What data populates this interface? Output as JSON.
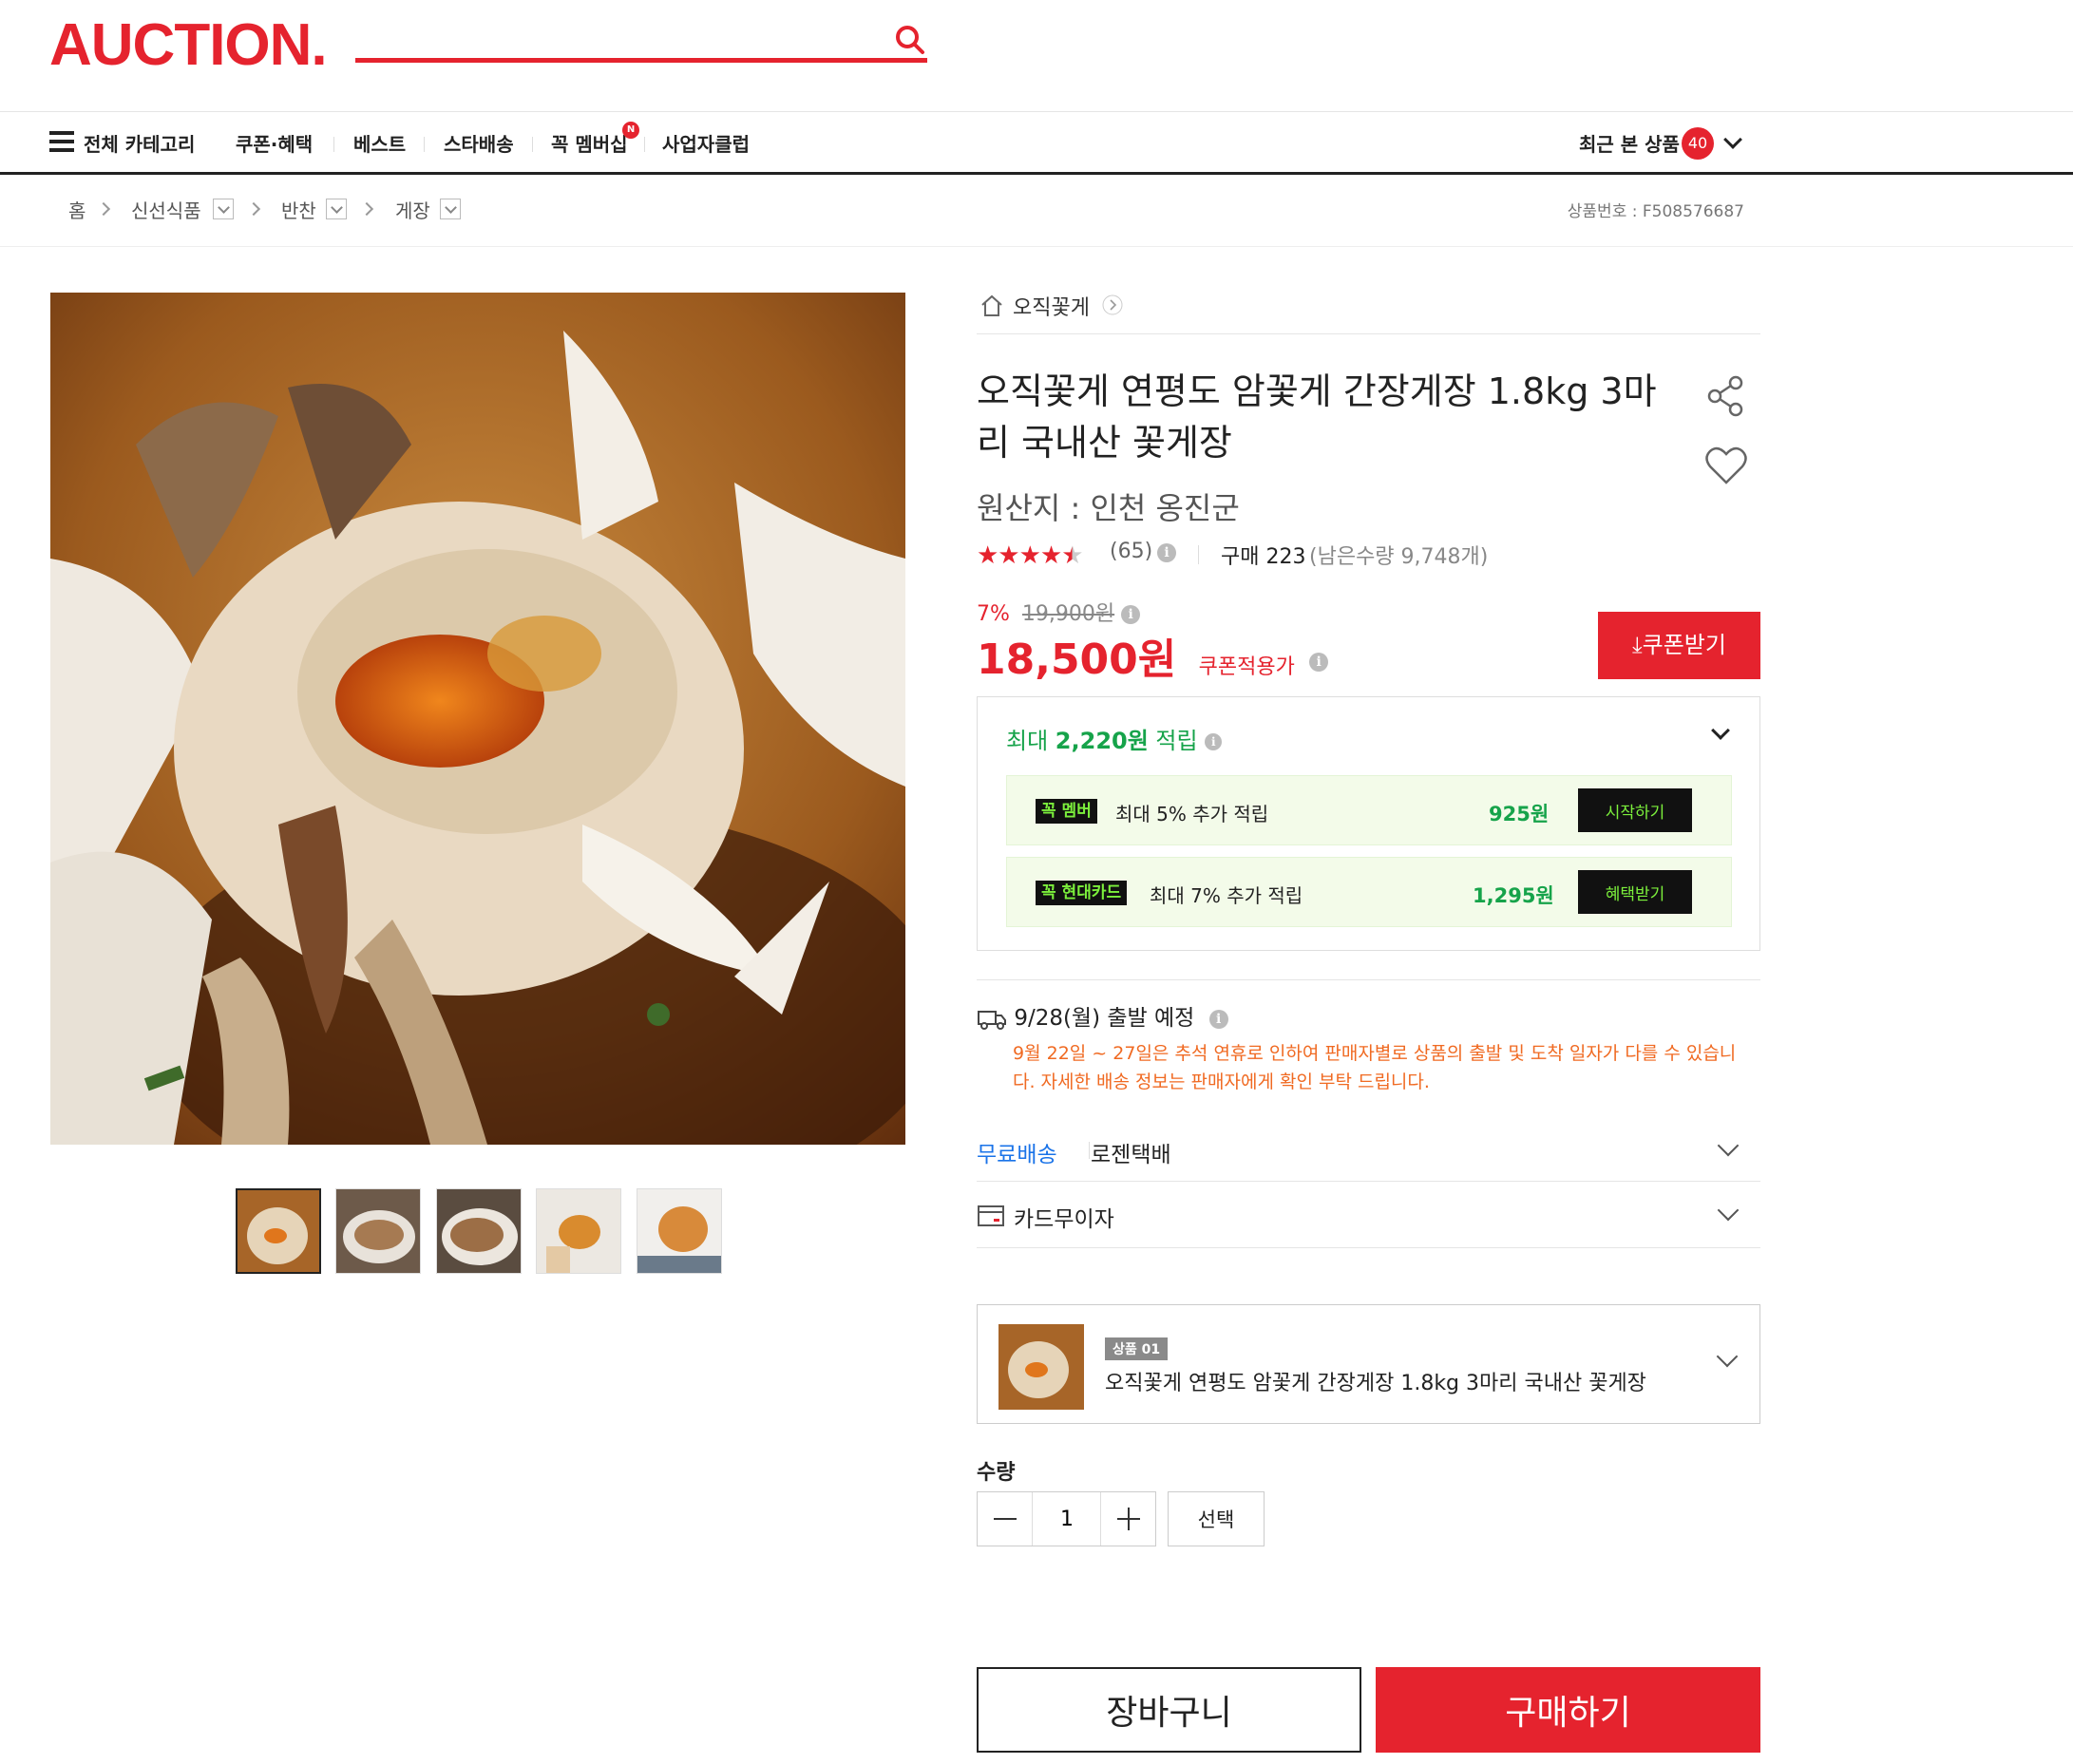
{
  "header": {
    "logo": "AUCTION.",
    "search_placeholder": ""
  },
  "nav": {
    "all_categories": "전체 카테고리",
    "items": [
      "쿠폰·혜택",
      "베스트",
      "스타배송",
      "꼭 멤버십",
      "사업자클럽"
    ],
    "membership_badge": "N",
    "recent_label": "최근 본 상품",
    "recent_count": "40"
  },
  "breadcrumb": {
    "items": [
      "홈",
      "신선식품",
      "반찬",
      "게장"
    ],
    "product_no": "상품번호 : F508576687"
  },
  "store": {
    "name": "오직꽃게"
  },
  "product": {
    "title": "오직꽃게 연평도 암꽃게 간장게장 1.8kg 3마리 국내산 꽃게장",
    "origin": "원산지 : 인천 옹진군",
    "rating_stars": 4.5,
    "review_count": "(65)",
    "purchase": "구매 223",
    "stock": "(남은수량 9,748개)",
    "discount_rate": "7%",
    "original_price": "19,900원",
    "price": "18,500원",
    "coupon_price_label": "쿠폰적용가",
    "coupon_button": "쿠폰받기"
  },
  "reward": {
    "title_prefix": "최대 ",
    "title_amount": "2,220원",
    "title_suffix": " 적립",
    "benefits": [
      {
        "tag": "꼭 멤버",
        "text": "최대 5% 추가 적립",
        "amount": "925원",
        "button": "시작하기"
      },
      {
        "tag": "꼭 현대카드",
        "text": "최대 7% 추가 적립",
        "amount": "1,295원",
        "button": "혜택받기"
      }
    ]
  },
  "shipping": {
    "departure": "9/28(월) 출발 예정",
    "note": "9월 22일 ~ 27일은 추석 연휴로 인하여 판매자별로 상품의 출발 및 도착 일자가 다를 수 있습니다. 자세한 배송 정보는 판매자에게 확인 부탁 드립니다.",
    "free_label": "무료배송",
    "carrier": "로젠택배",
    "card_installment": "카드무이자"
  },
  "option": {
    "badge": "상품 01",
    "name": "오직꽃게 연평도 암꽃게 간장게장 1.8kg 3마리 국내산 꽃게장"
  },
  "quantity": {
    "label": "수량",
    "value": "1",
    "select_button": "선택"
  },
  "actions": {
    "cart": "장바구니",
    "buy": "구매하기"
  },
  "colors": {
    "brand": "#e5232e",
    "green": "#16a34a",
    "notice": "#f06a22"
  }
}
